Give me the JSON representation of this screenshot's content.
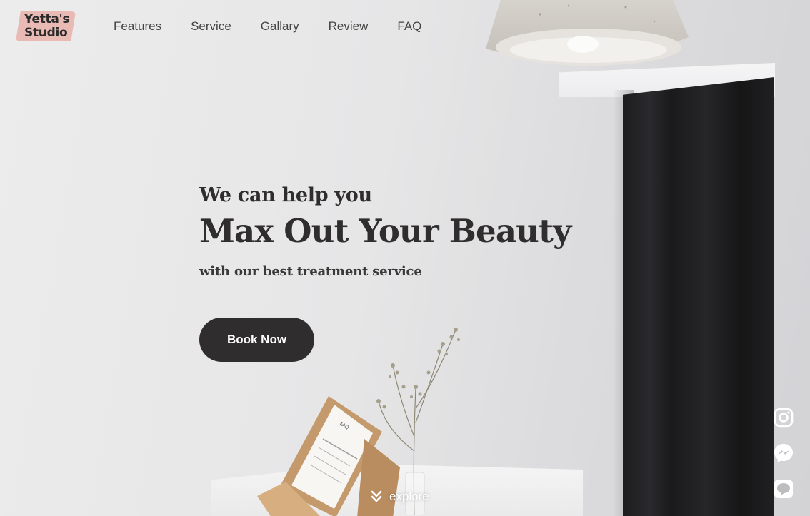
{
  "brand": {
    "logo_line1": "Yetta's",
    "logo_line2": "Studio",
    "logo_color": "#e9b9b4"
  },
  "nav": {
    "items": [
      {
        "label": "Features"
      },
      {
        "label": "Service"
      },
      {
        "label": "Gallary"
      },
      {
        "label": "Review"
      },
      {
        "label": "FAQ"
      }
    ]
  },
  "hero": {
    "pre_title": "We can help you",
    "title": "Max Out Your Beauty",
    "subtitle": "with our best treatment service",
    "cta_label": "Book Now",
    "cta_color": "#2f2d2d"
  },
  "explore": {
    "label": "explore",
    "icon": "double-chevron-down-icon"
  },
  "social": {
    "icons": [
      "instagram-icon",
      "messenger-icon",
      "line-icon"
    ]
  },
  "menu_card": {
    "title": "FAQ"
  }
}
